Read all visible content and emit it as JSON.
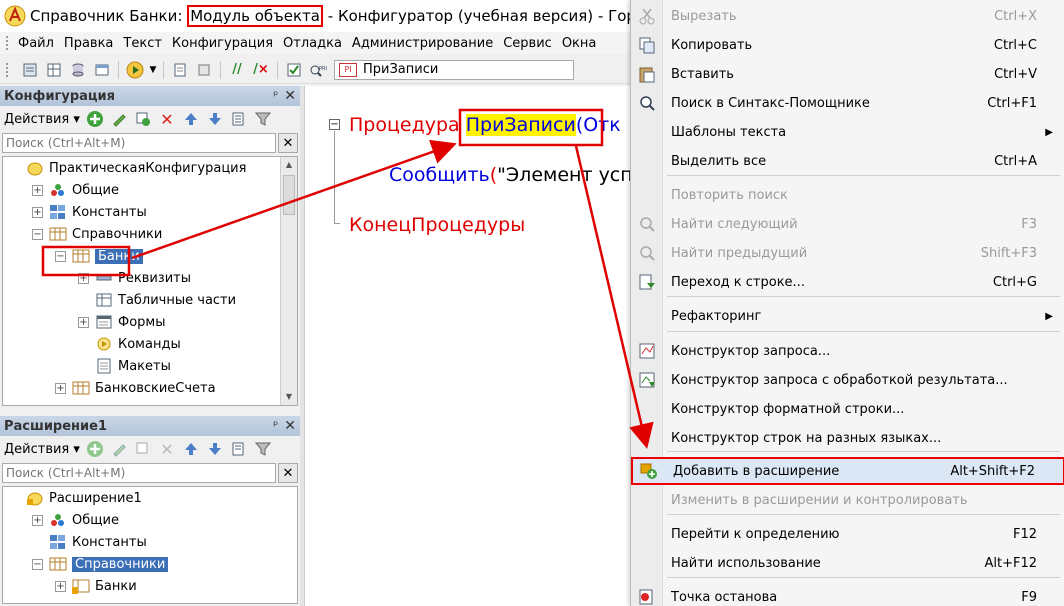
{
  "window": {
    "title_prefix": "Справочник Банки: ",
    "title_highlight": "Модуль объекта",
    "title_suffix": " - Конфигуратор (учебная версия) - Гордынец (пр"
  },
  "menubar": [
    {
      "label": "Файл"
    },
    {
      "label": "Правка"
    },
    {
      "label": "Текст"
    },
    {
      "label": "Конфигурация"
    },
    {
      "label": "Отладка"
    },
    {
      "label": "Администрирование"
    },
    {
      "label": "Сервис"
    },
    {
      "label": "Окна"
    }
  ],
  "toolbar": {
    "procedure_combo": "ПриЗаписи"
  },
  "config_panel": {
    "title": "Конфигурация",
    "actions_label": "Действия",
    "search_placeholder": "Поиск (Ctrl+Alt+M)",
    "tree": [
      {
        "label": "ПрактическаяКонфигурация",
        "level": 0,
        "icon": "config-icon",
        "expander": "none"
      },
      {
        "label": "Общие",
        "level": 1,
        "icon": "common-icon",
        "expander": "plus"
      },
      {
        "label": "Константы",
        "level": 1,
        "icon": "constants-icon",
        "expander": "plus"
      },
      {
        "label": "Справочники",
        "level": 1,
        "icon": "catalog-icon",
        "expander": "minus"
      },
      {
        "label": "Банки",
        "level": 2,
        "icon": "catalog-icon",
        "expander": "minus",
        "selected": true
      },
      {
        "label": "Реквизиты",
        "level": 3,
        "icon": "attribute-icon",
        "expander": "plus"
      },
      {
        "label": "Табличные части",
        "level": 3,
        "icon": "tabular-icon",
        "expander": "none"
      },
      {
        "label": "Формы",
        "level": 3,
        "icon": "form-icon",
        "expander": "plus"
      },
      {
        "label": "Команды",
        "level": 3,
        "icon": "command-icon",
        "expander": "none"
      },
      {
        "label": "Макеты",
        "level": 3,
        "icon": "template-icon",
        "expander": "none"
      },
      {
        "label": "БанковскиеСчета",
        "level": 2,
        "icon": "catalog-icon",
        "expander": "plus"
      }
    ]
  },
  "ext_panel": {
    "title": "Расширение1",
    "actions_label": "Действия",
    "search_placeholder": "Поиск (Ctrl+Alt+M)",
    "tree": [
      {
        "label": "Расширение1",
        "level": 0,
        "icon": "extension-icon",
        "expander": "none"
      },
      {
        "label": "Общие",
        "level": 1,
        "icon": "common-icon",
        "expander": "plus"
      },
      {
        "label": "Константы",
        "level": 1,
        "icon": "constants-icon",
        "expander": "none"
      },
      {
        "label": "Справочники",
        "level": 1,
        "icon": "catalog-icon",
        "expander": "minus",
        "selected": true
      },
      {
        "label": "Банки",
        "level": 2,
        "icon": "catalog-ext-icon",
        "expander": "plus"
      }
    ]
  },
  "editor": {
    "line1_kw": "Процедура ",
    "line1_name": "ПриЗаписи",
    "line1_rest": "(Отк",
    "line2_fn": "Сообщить",
    "line2_paren": "(",
    "line2_str": "\"Элемент усп",
    "line3_kw": "КонецПроцедуры"
  },
  "context_menu": [
    {
      "label": "Вырезать",
      "shortcut": "Ctrl+X",
      "disabled": true,
      "icon": "cut-icon"
    },
    {
      "label": "Копировать",
      "shortcut": "Ctrl+C",
      "icon": "copy-icon"
    },
    {
      "label": "Вставить",
      "shortcut": "Ctrl+V",
      "icon": "paste-icon"
    },
    {
      "label": "Поиск в Синтакс-Помощнике",
      "shortcut": "Ctrl+F1",
      "icon": "syntax-help-icon"
    },
    {
      "label": "Шаблоны текста",
      "shortcut": "",
      "submenu": true
    },
    {
      "label": "Выделить все",
      "shortcut": "Ctrl+A"
    },
    {
      "label": "Повторить поиск",
      "shortcut": "",
      "disabled": true
    },
    {
      "label": "Найти следующий",
      "shortcut": "F3",
      "disabled": true,
      "icon": "find-next-icon"
    },
    {
      "label": "Найти предыдущий",
      "shortcut": "Shift+F3",
      "disabled": true,
      "icon": "find-prev-icon"
    },
    {
      "label": "Переход к строке...",
      "shortcut": "Ctrl+G",
      "icon": "goto-line-icon"
    },
    {
      "label": "Рефакторинг",
      "shortcut": "",
      "submenu": true
    },
    {
      "label": "Конструктор запроса...",
      "shortcut": "",
      "icon": "query-builder-icon"
    },
    {
      "label": "Конструктор запроса с обработкой результата...",
      "shortcut": "",
      "icon": "query-result-icon"
    },
    {
      "label": "Конструктор форматной строки...",
      "shortcut": ""
    },
    {
      "label": "Конструктор строк на разных языках...",
      "shortcut": ""
    },
    {
      "label": "Добавить в расширение",
      "shortcut": "Alt+Shift+F2",
      "icon": "add-extension-icon",
      "highlighted": true
    },
    {
      "label": "Изменить в расширении и контролировать",
      "shortcut": "",
      "disabled": true
    },
    {
      "label": "Перейти к определению",
      "shortcut": "F12"
    },
    {
      "label": "Найти использование",
      "shortcut": "Alt+F12"
    },
    {
      "label": "Точка останова",
      "shortcut": "F9",
      "icon": "breakpoint-icon"
    }
  ],
  "colors": {
    "annotation": "#e00000",
    "selection": "#3d6fb6",
    "keyword": "#e00000",
    "function": "#0000e0",
    "identifier_highlight": "#fff200"
  }
}
